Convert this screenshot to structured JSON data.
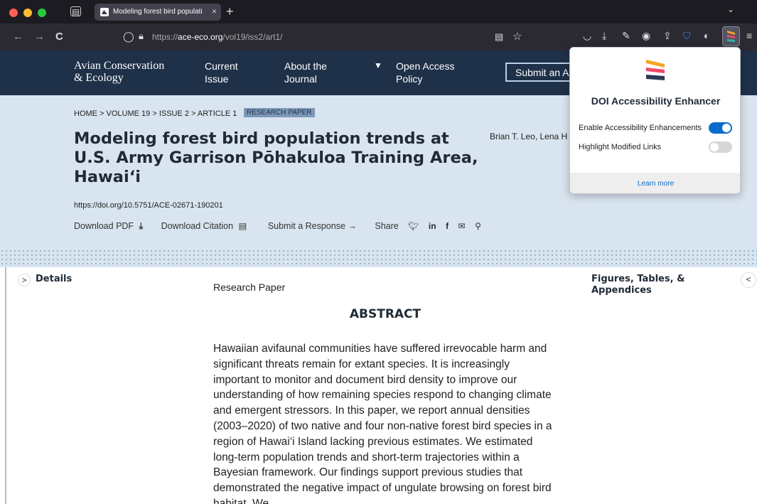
{
  "browser": {
    "tab": {
      "title": "Modeling forest bird population",
      "close": "×"
    },
    "new_tab": "+",
    "tab_list": "⌄",
    "nav": {
      "back": "←",
      "forward": "→",
      "reload": "C"
    },
    "url": {
      "prefix": "https://",
      "domain": "ace-eco.org",
      "path": "/vol19/iss2/art1/"
    }
  },
  "site": {
    "logo_line1": "Avian Conservation",
    "logo_line2": "& Ecology",
    "nav": [
      {
        "line1": "Current",
        "line2": "Issue"
      },
      {
        "line1": "About the",
        "line2": "Journal"
      },
      {
        "line1": "Open Access",
        "line2": "Policy"
      }
    ],
    "submit": "Submit an Article"
  },
  "article": {
    "breadcrumb": "HOME > VOLUME 19 > ISSUE 2 > ARTICLE 1",
    "badge": "RESEARCH PAPER",
    "title": "Modeling forest bird population trends at U.S. Army Garrison Pōhakuloa Training Area, Hawai‘i",
    "authors": "Brian T. Leo, Lena H",
    "doi": "https://doi.org/10.5751/ACE-02671-190201",
    "actions": {
      "download_pdf": "Download PDF",
      "download_citation": "Download Citation",
      "submit_response": "Submit a Response →",
      "share": "Share"
    }
  },
  "body": {
    "details": "Details",
    "paper_type": "Research Paper",
    "abstract_heading": "ABSTRACT",
    "abstract": "Hawaiian avifaunal communities have suffered irrevocable harm and significant threats remain for extant species. It is increasingly important to monitor and document bird density to improve our understanding of how remaining species respond to changing climate and emergent stressors. In this paper, we report annual densities (2003–2020) of two native and four non-native forest bird species in a region of Hawai‘i Island lacking previous estimates. We estimated long-term population trends and short-term trajectories within a Bayesian framework. Our findings support previous studies that demonstrated the negative impact of ungulate browsing on forest bird habitat. We",
    "figures": "Figures, Tables, & Appendices",
    "details_toggle": ">",
    "figures_toggle": "<"
  },
  "popup": {
    "title": "DOI Accessibility Enhancer",
    "options": [
      {
        "label": "Enable Accessibility Enhancements",
        "enabled": true
      },
      {
        "label": "Highlight Modified Links",
        "enabled": false
      }
    ],
    "learn_more": "Learn more"
  },
  "colors": {
    "site_header": "#1f3148",
    "article_bg": "#d8e4ef",
    "toggle_on": "#0b6bcb"
  }
}
